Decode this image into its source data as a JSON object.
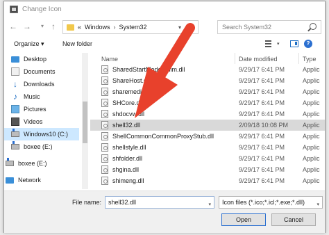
{
  "window": {
    "title": "Change Icon"
  },
  "address": {
    "crumbs": [
      "Windows",
      "System32"
    ],
    "prefix": "«"
  },
  "search": {
    "placeholder": "Search System32"
  },
  "toolbar": {
    "organize_label": "Organize ▾",
    "new_folder_label": "New folder"
  },
  "nav": {
    "items": [
      {
        "label": "Desktop",
        "icon": "desktop-icon"
      },
      {
        "label": "Documents",
        "icon": "documents-icon"
      },
      {
        "label": "Downloads",
        "icon": "download-icon"
      },
      {
        "label": "Music",
        "icon": "music-icon"
      },
      {
        "label": "Pictures",
        "icon": "pictures-icon"
      },
      {
        "label": "Videos",
        "icon": "videos-icon"
      },
      {
        "label": "Windows10 (C:)",
        "icon": "drive-icon",
        "selected": true
      },
      {
        "label": "boxee (E:)",
        "icon": "drive-icon"
      },
      {
        "label": "boxee (E:)",
        "icon": "drive-icon"
      },
      {
        "label": "Network",
        "icon": "network-icon"
      }
    ]
  },
  "list": {
    "columns": {
      "name": "Name",
      "date": "Date modified",
      "type": "Type"
    },
    "rows": [
      {
        "name": "SharedStartModelShim.dll",
        "date": "9/29/17 6:41 PM",
        "type": "Applic"
      },
      {
        "name": "ShareHost.dll",
        "date": "9/29/17 6:41 PM",
        "type": "Applic"
      },
      {
        "name": "sharemediacpl.dll",
        "date": "9/29/17 6:41 PM",
        "type": "Applic"
      },
      {
        "name": "SHCore.dll",
        "date": "9/29/17 6:41 PM",
        "type": "Applic"
      },
      {
        "name": "shdocvw.dll",
        "date": "9/29/17 6:41 PM",
        "type": "Applic"
      },
      {
        "name": "shell32.dll",
        "date": "2/09/18 10:08 PM",
        "type": "Applic",
        "selected": true
      },
      {
        "name": "ShellCommonCommonProxyStub.dll",
        "date": "9/29/17 6:41 PM",
        "type": "Applic"
      },
      {
        "name": "shellstyle.dll",
        "date": "9/29/17 6:41 PM",
        "type": "Applic"
      },
      {
        "name": "shfolder.dll",
        "date": "9/29/17 6:41 PM",
        "type": "Applic"
      },
      {
        "name": "shgina.dll",
        "date": "9/29/17 6:41 PM",
        "type": "Applic"
      },
      {
        "name": "shimeng.dll",
        "date": "9/29/17 6:41 PM",
        "type": "Applic"
      }
    ]
  },
  "footer": {
    "file_name_label": "File name:",
    "file_name_value": "shell32.dll",
    "file_type_value": "Icon files (*.ico;*.icl;*.exe;*.dll)",
    "open_label": "Open",
    "cancel_label": "Cancel"
  },
  "colors": {
    "accent": "#1f6fc4",
    "arrow": "#e8412c",
    "selection": "#cde8ff"
  }
}
